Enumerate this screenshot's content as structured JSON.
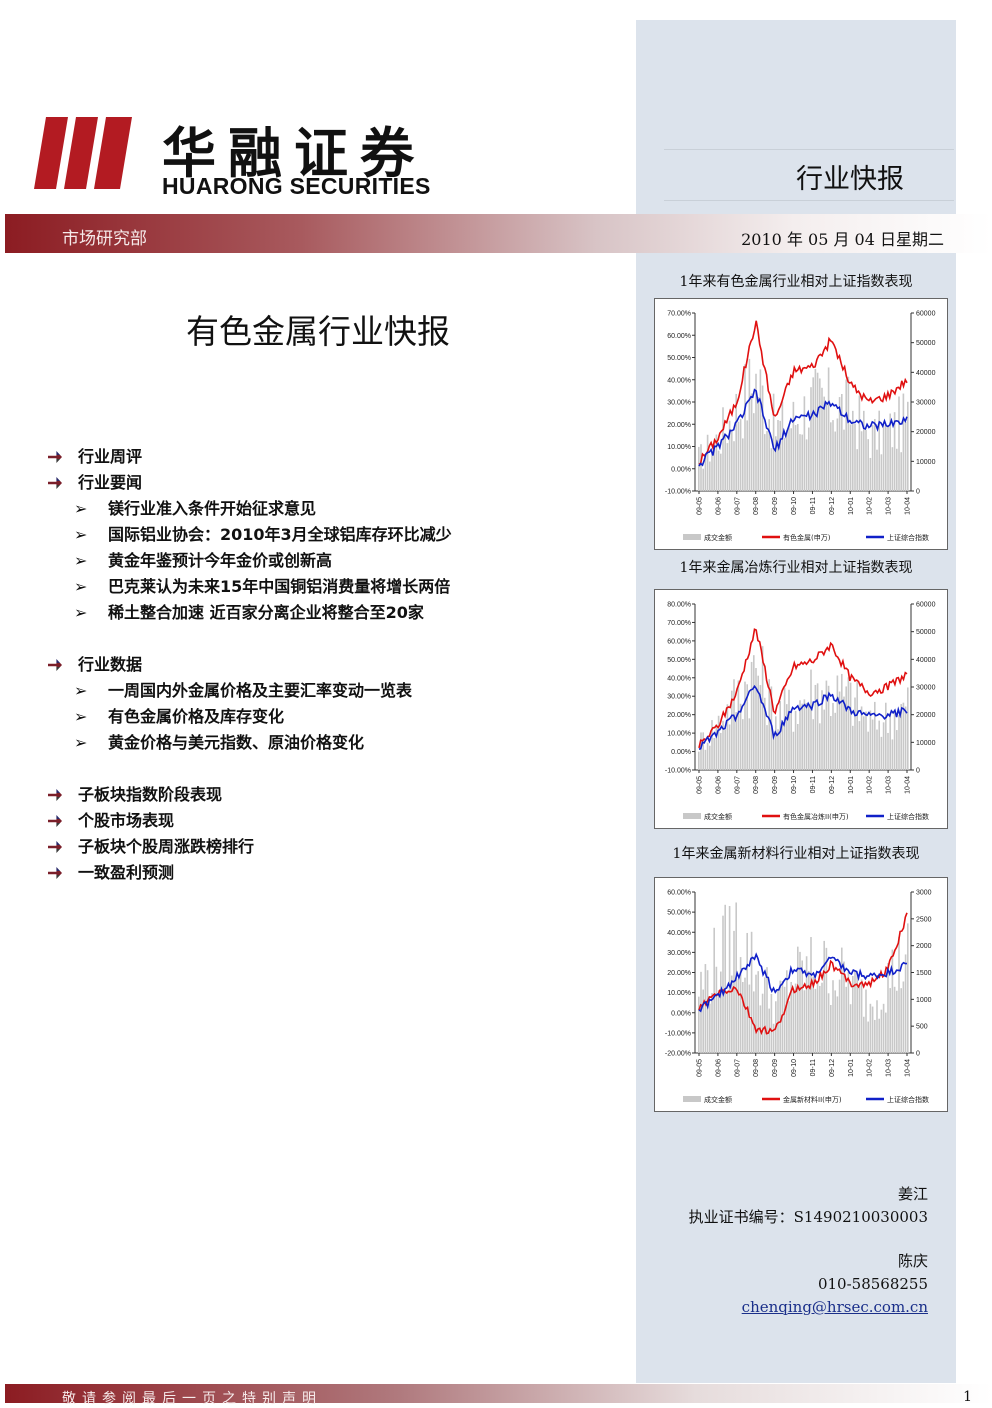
{
  "header": {
    "logo_cn": "华融证券",
    "logo_en": "HUARONG SECURITIES",
    "report_type": "行业快报",
    "department": "市场研究部",
    "date": "2010 年 05 月 04 日星期二"
  },
  "title": "有色金属行业快报",
  "toc": [
    {
      "level": 1,
      "text": "行业周评"
    },
    {
      "level": 1,
      "text": "行业要闻"
    },
    {
      "level": 2,
      "text": "镁行业准入条件开始征求意见"
    },
    {
      "level": 2,
      "text": "国际铝业协会：2010年3月全球铝库存环比减少"
    },
    {
      "level": 2,
      "text": "黄金年鉴预计今年金价或创新高"
    },
    {
      "level": 2,
      "text": "巴克莱认为未来15年中国铜铝消费量将增长两倍"
    },
    {
      "level": 2,
      "text": "稀土整合加速 近百家分离企业将整合至20家"
    },
    {
      "level": 1,
      "text": "行业数据"
    },
    {
      "level": 2,
      "text": "一周国内外金属价格及主要汇率变动一览表"
    },
    {
      "level": 2,
      "text": "有色金属价格及库存变化"
    },
    {
      "level": 2,
      "text": "黄金价格与美元指数、原油价格变化"
    },
    {
      "level": 1,
      "text": "子板块指数阶段表现"
    },
    {
      "level": 1,
      "text": "个股市场表现"
    },
    {
      "level": 1,
      "text": "子板块个股周涨跌榜排行"
    },
    {
      "level": 1,
      "text": "一致盈利预测"
    }
  ],
  "colors": {
    "brand": "#8c1c22",
    "panel": "#dce3ec",
    "sector_line": "#e01010",
    "index_line": "#1020c8",
    "volume_bar": "#c8c8c8"
  },
  "chart_data": [
    {
      "type": "line",
      "caption": "1年来有色金属行业相对上证指数表现",
      "x": [
        "09-05",
        "09-06",
        "09-07",
        "09-08",
        "09-09",
        "09-10",
        "09-11",
        "09-12",
        "10-01",
        "10-02",
        "10-03",
        "10-04"
      ],
      "left_ticks": [
        "70.00%",
        "60.00%",
        "50.00%",
        "40.00%",
        "30.00%",
        "20.00%",
        "10.00%",
        "0.00%",
        "-10.00%"
      ],
      "right_ticks": [
        "60000",
        "50000",
        "40000",
        "30000",
        "20000",
        "10000",
        "0"
      ],
      "ylim_left": [
        -10,
        70
      ],
      "ylim_right": [
        0,
        60000
      ],
      "series": [
        {
          "name": "成交金额",
          "kind": "bar",
          "axis": "right",
          "values": [
            11000,
            18000,
            28000,
            38000,
            21000,
            24000,
            30000,
            29000,
            27000,
            18000,
            20000,
            24000
          ]
        },
        {
          "name": "有色金属(申万)",
          "kind": "line",
          "axis": "left",
          "values": [
            3,
            14,
            30,
            66,
            22,
            44,
            46,
            58,
            38,
            30,
            33,
            40
          ]
        },
        {
          "name": "上证综合指数",
          "kind": "line",
          "axis": "left",
          "values": [
            2,
            10,
            20,
            35,
            8,
            23,
            24,
            30,
            22,
            19,
            20,
            22
          ]
        }
      ]
    },
    {
      "type": "line",
      "caption": "1年来金属冶炼行业相对上证指数表现",
      "x": [
        "09-05",
        "09-06",
        "09-07",
        "09-08",
        "09-09",
        "09-10",
        "09-11",
        "09-12",
        "10-01",
        "10-02",
        "10-03",
        "10-04"
      ],
      "left_ticks": [
        "80.00%",
        "70.00%",
        "60.00%",
        "50.00%",
        "40.00%",
        "30.00%",
        "20.00%",
        "10.00%",
        "0.00%",
        "-10.00%"
      ],
      "right_ticks": [
        "60000",
        "50000",
        "40000",
        "30000",
        "20000",
        "10000",
        "0"
      ],
      "ylim_left": [
        -10,
        80
      ],
      "ylim_right": [
        0,
        60000
      ],
      "series": [
        {
          "name": "成交金额",
          "kind": "bar",
          "axis": "right",
          "values": [
            10000,
            17000,
            27000,
            37000,
            20000,
            23000,
            29000,
            28000,
            26000,
            17000,
            19000,
            23000
          ]
        },
        {
          "name": "有色金属冶炼II(申万)",
          "kind": "line",
          "axis": "left",
          "values": [
            3,
            14,
            32,
            67,
            21,
            46,
            49,
            58,
            40,
            32,
            35,
            42
          ]
        },
        {
          "name": "上证综合指数",
          "kind": "line",
          "axis": "left",
          "values": [
            2,
            10,
            20,
            36,
            8,
            24,
            25,
            31,
            22,
            19,
            20,
            22
          ]
        }
      ]
    },
    {
      "type": "line",
      "caption": "1年来金属新材料行业相对上证指数表现",
      "x": [
        "09-05",
        "09-06",
        "09-07",
        "09-08",
        "09-09",
        "09-10",
        "09-11",
        "09-12",
        "10-01",
        "10-02",
        "10-03",
        "10-04"
      ],
      "left_ticks": [
        "60.00%",
        "50.00%",
        "40.00%",
        "30.00%",
        "20.00%",
        "10.00%",
        "0.00%",
        "-10.00%",
        "-20.00%"
      ],
      "right_ticks": [
        "3000",
        "2500",
        "2000",
        "1500",
        "1000",
        "500",
        "0"
      ],
      "ylim_left": [
        -20,
        60
      ],
      "ylim_right": [
        0,
        3000
      ],
      "series": [
        {
          "name": "成交金额",
          "kind": "bar",
          "axis": "right",
          "values": [
            1200,
            1800,
            2200,
            1500,
            900,
            1400,
            1600,
            1500,
            1300,
            900,
            1400,
            1800
          ]
        },
        {
          "name": "金属新材料II(申万)",
          "kind": "line",
          "axis": "left",
          "values": [
            2,
            10,
            12,
            -8,
            -10,
            12,
            14,
            24,
            15,
            14,
            22,
            48
          ]
        },
        {
          "name": "上证综合指数",
          "kind": "line",
          "axis": "left",
          "values": [
            2,
            8,
            18,
            28,
            10,
            22,
            18,
            27,
            20,
            18,
            20,
            24
          ]
        }
      ]
    }
  ],
  "authors": {
    "name1": "姜江",
    "license": "执业证书编号：S1490210030003",
    "name2": "陈庆",
    "phone": "010-58568255",
    "email": "chenqing@hrsec.com.cn"
  },
  "footer": {
    "notice": "敬请参阅最后一页之特别声明",
    "page": "1"
  }
}
